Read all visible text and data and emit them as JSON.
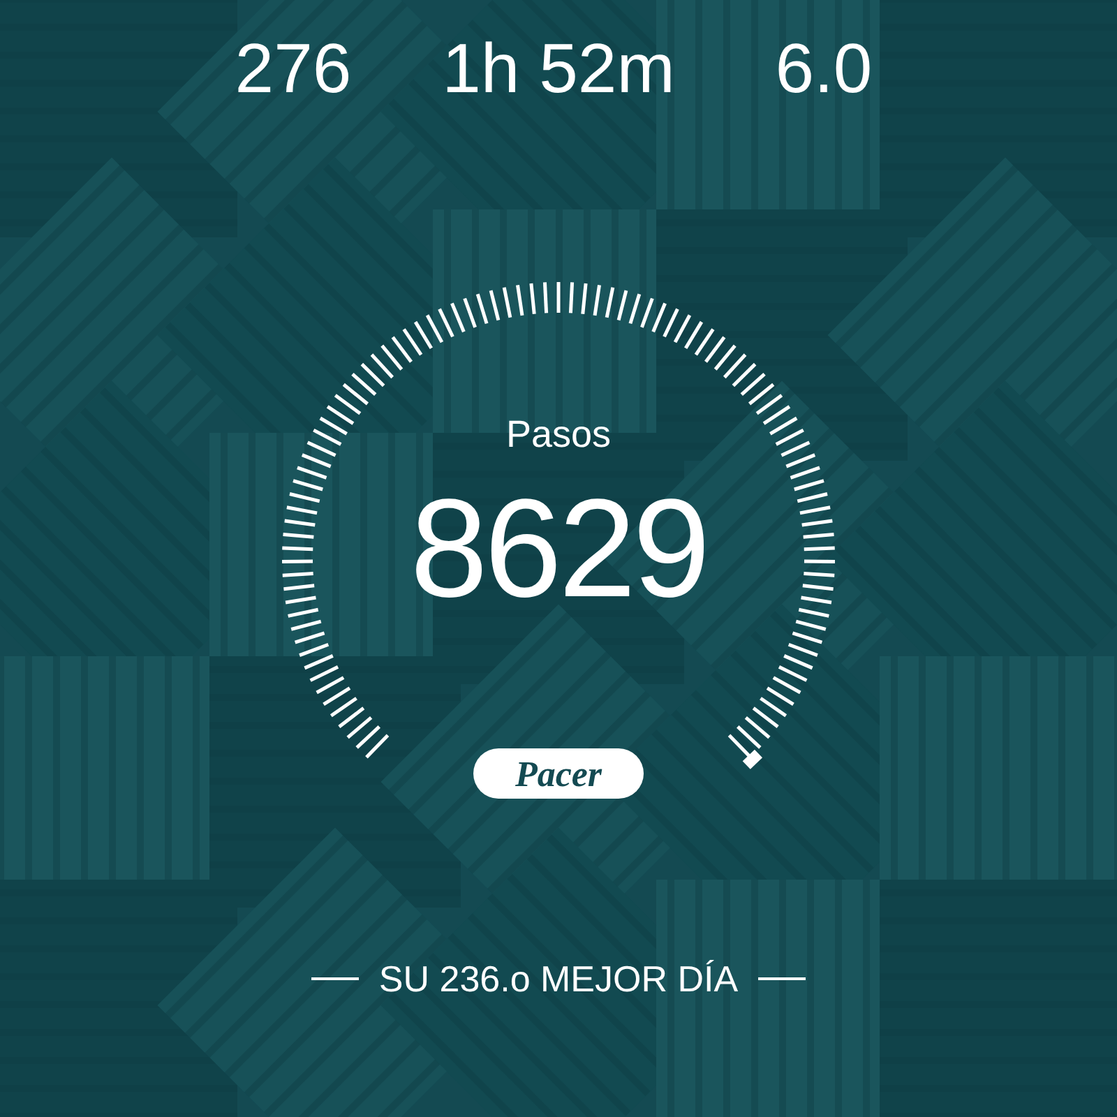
{
  "stats": [
    {
      "value": "276"
    },
    {
      "value": "1h 52m"
    },
    {
      "value": "6.0"
    }
  ],
  "gauge": {
    "label": "Pasos",
    "value": "8629"
  },
  "brand": {
    "logo": "Pacer"
  },
  "best_day": "SU 236.o MEJOR DÍA"
}
